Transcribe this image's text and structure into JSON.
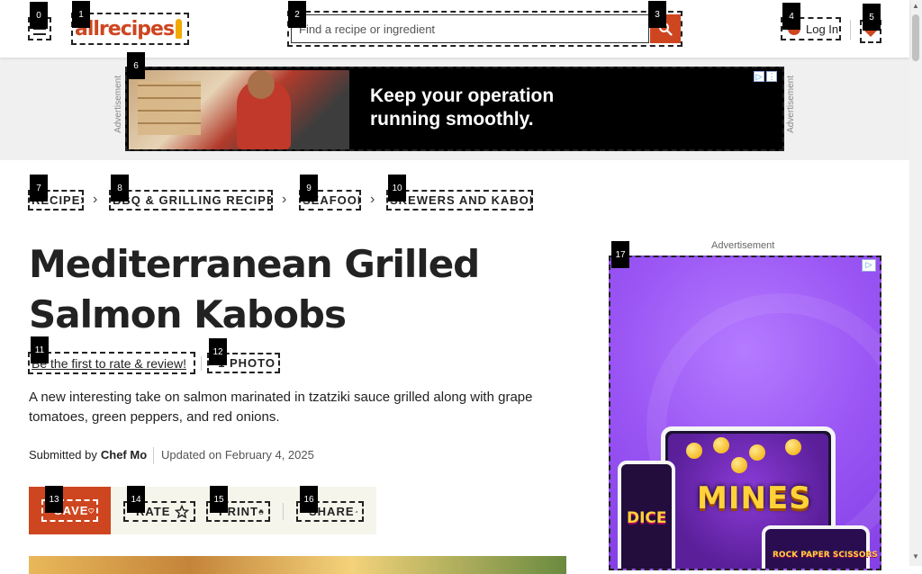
{
  "header": {
    "logo_text": "allrecipes",
    "search_placeholder": "Find a recipe or ingredient",
    "login_label": "Log In"
  },
  "ad_banner": {
    "label": "Advertisement",
    "headline_line1": "Keep your operation",
    "headline_line2": "running smoothly."
  },
  "breadcrumbs": [
    {
      "label": "RECIPES"
    },
    {
      "label": "BBQ & GRILLING RECIPES"
    },
    {
      "label": "SEAFOOD"
    },
    {
      "label": "SKEWERS AND KABOBS"
    }
  ],
  "recipe": {
    "title_line1": "Mediterranean Grilled",
    "title_line2": "Salmon Kabobs",
    "rate_link": "Be the first to rate & review!",
    "photo_link": "1 PHOTO",
    "description": "A new interesting take on salmon marinated in tzatziki sauce grilled along with grape tomatoes, green peppers, and red onions.",
    "submitted_prefix": "Submitted by",
    "author": "Chef Mo",
    "updated": "Updated on February 4, 2025"
  },
  "actions": {
    "save": "SAVE",
    "rate": "RATE",
    "print": "PRINT",
    "share": "SHARE"
  },
  "side_ad": {
    "label": "Advertisement",
    "game1": "MINES",
    "game2": "DICE",
    "game3": "ROCK PAPER SCISSORS"
  },
  "tags": [
    "0",
    "1",
    "2",
    "3",
    "4",
    "5",
    "6",
    "7",
    "8",
    "9",
    "10",
    "11",
    "12",
    "13",
    "14",
    "15",
    "16",
    "17"
  ],
  "colors": {
    "brand": "#ce4620",
    "action_bar_bg": "#f5f5ec",
    "side_ad_bg": "#9a55f4"
  }
}
